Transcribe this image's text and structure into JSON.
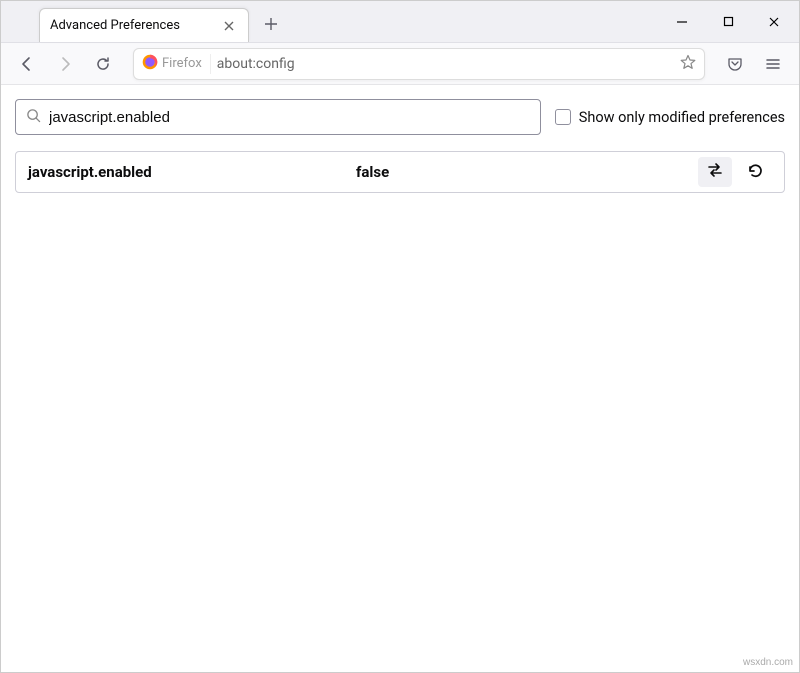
{
  "window": {
    "tab_title": "Advanced Preferences"
  },
  "urlbar": {
    "identity_label": "Firefox",
    "url": "about:config"
  },
  "search": {
    "value": "javascript.enabled",
    "modified_label": "Show only modified preferences"
  },
  "pref": {
    "name": "javascript.enabled",
    "value": "false"
  },
  "watermark": "wsxdn.com"
}
